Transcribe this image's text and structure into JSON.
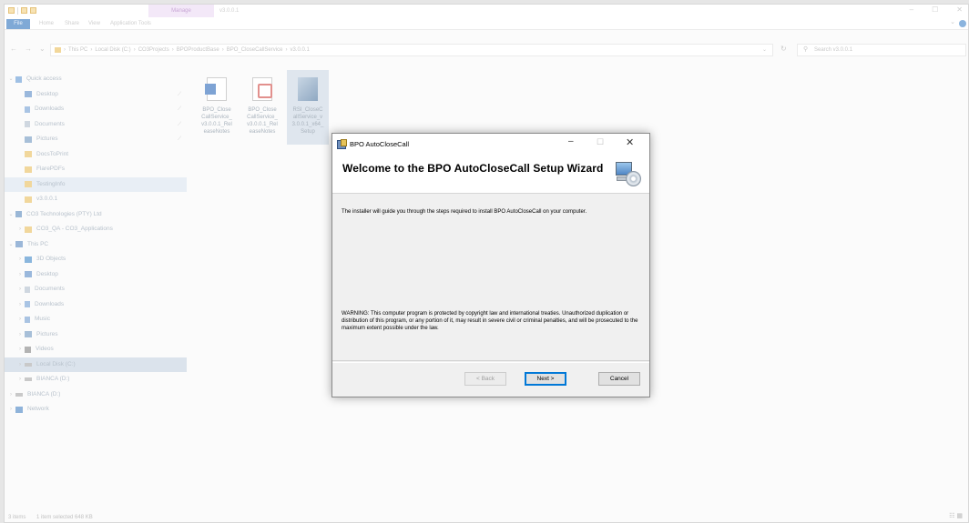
{
  "explorer": {
    "contextual_tab": "Manage",
    "window_title": "v3.0.0.1",
    "ribbon_tabs": [
      "File",
      "Home",
      "Share",
      "View",
      "Application Tools"
    ],
    "breadcrumbs": [
      "This PC",
      "Local Disk (C:)",
      "CO3Projects",
      "BPOProductBase",
      "BPO_CloseCallService",
      "v3.0.0.1"
    ],
    "search_placeholder": "Search v3.0.0.1",
    "sidebar": [
      {
        "label": "Quick access",
        "chev": "⌄",
        "icon": "star",
        "indent": 1
      },
      {
        "label": "Desktop",
        "icon": "desk",
        "indent": 2,
        "pin": true
      },
      {
        "label": "Downloads",
        "icon": "down",
        "indent": 2,
        "pin": true
      },
      {
        "label": "Documents",
        "icon": "doc",
        "indent": 2,
        "pin": true
      },
      {
        "label": "Pictures",
        "icon": "pic",
        "indent": 2,
        "pin": true
      },
      {
        "label": "DocsToPrint",
        "icon": "fold",
        "indent": 2
      },
      {
        "label": "FlarePDFs",
        "icon": "fold",
        "indent": 2
      },
      {
        "label": "TestingInfo",
        "icon": "fold",
        "indent": 2,
        "state": "sel"
      },
      {
        "label": "v3.0.0.1",
        "icon": "fold",
        "indent": 2
      },
      {
        "label": "CO3 Technologies (PTY) Ltd",
        "chev": "⌄",
        "icon": "org",
        "indent": 1
      },
      {
        "label": "CO3_QA - CO3_Applications",
        "chev": "›",
        "icon": "fold",
        "indent": 2
      },
      {
        "label": "This PC",
        "chev": "⌄",
        "icon": "pc",
        "indent": 1
      },
      {
        "label": "3D Objects",
        "chev": "›",
        "icon": "obj",
        "indent": 2
      },
      {
        "label": "Desktop",
        "chev": "›",
        "icon": "desk",
        "indent": 2
      },
      {
        "label": "Documents",
        "chev": "›",
        "icon": "doc",
        "indent": 2
      },
      {
        "label": "Downloads",
        "chev": "›",
        "icon": "down",
        "indent": 2
      },
      {
        "label": "Music",
        "chev": "›",
        "icon": "mus",
        "indent": 2
      },
      {
        "label": "Pictures",
        "chev": "›",
        "icon": "pic",
        "indent": 2
      },
      {
        "label": "Videos",
        "chev": "›",
        "icon": "vid",
        "indent": 2
      },
      {
        "label": "Local Disk (C:)",
        "chev": "›",
        "icon": "drv",
        "indent": 2,
        "state": "hl"
      },
      {
        "label": "BIANCA (D:)",
        "chev": "›",
        "icon": "drv",
        "indent": 2
      },
      {
        "label": "BIANCA (D:)",
        "chev": "›",
        "icon": "drv",
        "indent": 1
      },
      {
        "label": "Network",
        "chev": "›",
        "icon": "net",
        "indent": 1
      }
    ],
    "files": [
      {
        "name": "BPO_CloseCallService_v3.0.0.1_ReleaseNotes",
        "lines": [
          "BPO_Close",
          "CallService_",
          "v3.0.0.1_Rel",
          "easeNotes"
        ],
        "thumb": "word"
      },
      {
        "name": "BPO_CloseCallService_v3.0.0.1_ReleaseNotes",
        "lines": [
          "BPO_Close",
          "CallService_",
          "v3.0.0.1_Rel",
          "easeNotes"
        ],
        "thumb": "pdf"
      },
      {
        "name": "RSI_CloseCallService_v3.0.0.1_x64_Setup",
        "lines": [
          "RSI_CloseC",
          "allService_v",
          "3.0.0.1_x64_",
          "Setup"
        ],
        "thumb": "setup",
        "selected": true
      }
    ],
    "status": {
      "items": "3 items",
      "selected": "1 item selected  648 KB"
    }
  },
  "dialog": {
    "title": "BPO AutoCloseCall",
    "heading": "Welcome to the BPO AutoCloseCall Setup Wizard",
    "intro": "The installer will guide you through the steps required to install BPO AutoCloseCall on your computer.",
    "warning": "WARNING: This computer program is protected by copyright law and international treaties. Unauthorized duplication or distribution of this program, or any portion of it, may result in severe civil or criminal penalties, and will be prosecuted to the maximum extent possible under the law.",
    "buttons": {
      "back": "< Back",
      "next": "Next >",
      "cancel": "Cancel"
    },
    "controls": {
      "minimize": "–",
      "maximize": "☐",
      "close": "✕"
    }
  }
}
